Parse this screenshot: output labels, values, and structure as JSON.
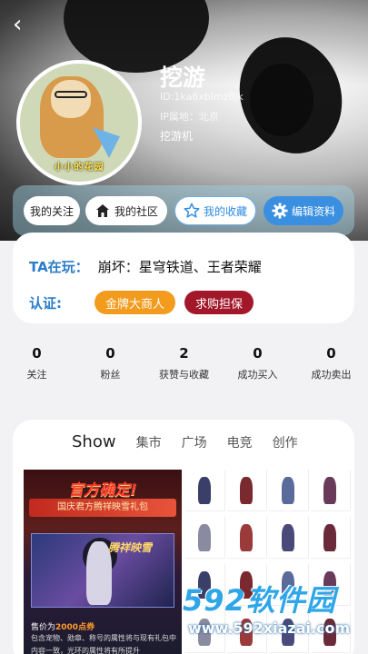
{
  "profile": {
    "name": "挖游",
    "id_text": "ID:1ka6xblmz8jk",
    "ip_text": "IP属地：北京",
    "game_label": "挖游机",
    "avatar_caption": "小小的花园"
  },
  "actions": {
    "follow": "我的关注",
    "community": "我的社区",
    "collect": "我的收藏",
    "edit": "编辑资料"
  },
  "info": {
    "playing_label": "TA在玩：",
    "playing_value": "崩坏：星穹铁道、王者荣耀",
    "cert_label": "认证:",
    "badges": [
      "金牌大商人",
      "求购担保"
    ]
  },
  "stats": [
    {
      "value": "0",
      "label": "关注"
    },
    {
      "value": "0",
      "label": "粉丝"
    },
    {
      "value": "2",
      "label": "获赞与收藏"
    },
    {
      "value": "0",
      "label": "成功买入"
    },
    {
      "value": "0",
      "label": "成功卖出"
    }
  ],
  "tabs": [
    "Show",
    "集市",
    "广场",
    "电竞",
    "创作"
  ],
  "promo": {
    "title": "官方确定!",
    "subtitle": "国庆君方腾祥映雪礼包",
    "art_logo": "腾祥映雪",
    "line1_a": "售价为",
    "line1_b": "2000点券",
    "line2": "包含宠物、勋章、称号的属性将与现有礼包中",
    "line3": "内容一致，光环的属性将有所提升"
  },
  "watermark": {
    "main": "592软件园",
    "sub": "www.592xiazai.com"
  },
  "colors": {
    "accent_blue": "#3a8fe0",
    "label_blue": "#2a7cc9",
    "gold_badge": "#f39b1c",
    "red_badge": "#a21729"
  }
}
